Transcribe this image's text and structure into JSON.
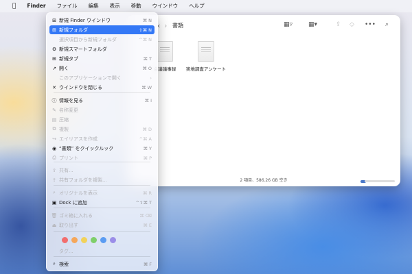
{
  "menubar": {
    "apple_icon": "apple-icon",
    "items": [
      "Finder",
      "ファイル",
      "編集",
      "表示",
      "移動",
      "ウインドウ",
      "ヘルプ"
    ]
  },
  "finder": {
    "back": "‹",
    "forward": "›",
    "title": "書類",
    "files": [
      {
        "name": "会議議事録"
      },
      {
        "name": "実地調査アンケート"
      }
    ],
    "status": "2 項目、586.26 GB 空き"
  },
  "menu": {
    "items": [
      {
        "icon": "⊞",
        "label": "新規 Finder ウインドウ",
        "shortcut": "⌘ N",
        "disabled": false,
        "highlight": false
      },
      {
        "icon": "⊞",
        "label": "新規フォルダ",
        "shortcut": "⇧⌘ N",
        "disabled": false,
        "highlight": true
      },
      {
        "icon": "",
        "label": "選択項目から新規フォルダ",
        "shortcut": "^⌘ N",
        "disabled": true,
        "highlight": false
      },
      {
        "icon": "⚙",
        "label": "新規スマートフォルダ",
        "shortcut": "",
        "disabled": false,
        "highlight": false
      },
      {
        "icon": "⊞",
        "label": "新規タブ",
        "shortcut": "⌘ T",
        "disabled": false,
        "highlight": false
      },
      {
        "icon": "↗",
        "label": "開く",
        "shortcut": "⌘ O",
        "disabled": false,
        "highlight": false
      },
      {
        "icon": "",
        "label": "このアプリケーションで開く",
        "shortcut": "›",
        "disabled": true,
        "highlight": false
      },
      {
        "icon": "✕",
        "label": "ウインドウを閉じる",
        "shortcut": "⌘ W",
        "disabled": false,
        "highlight": false
      },
      {
        "icon": "ⓘ",
        "label": "情報を見る",
        "shortcut": "⌘ I",
        "disabled": false,
        "highlight": false
      },
      {
        "icon": "✎",
        "label": "名称変更",
        "shortcut": "",
        "disabled": true,
        "highlight": false
      },
      {
        "icon": "▤",
        "label": "圧縮",
        "shortcut": "",
        "disabled": true,
        "highlight": false
      },
      {
        "icon": "⧉",
        "label": "複製",
        "shortcut": "⌘ D",
        "disabled": true,
        "highlight": false
      },
      {
        "icon": "↪",
        "label": "エイリアスを作成",
        "shortcut": "^⌘ A",
        "disabled": true,
        "highlight": false
      },
      {
        "icon": "◉",
        "label": "“書類” をクイックルック",
        "shortcut": "⌘ Y",
        "disabled": false,
        "highlight": false
      },
      {
        "icon": "⎙",
        "label": "プリント",
        "shortcut": "⌘ P",
        "disabled": true,
        "highlight": false
      },
      {
        "icon": "⇪",
        "label": "共有...",
        "shortcut": "",
        "disabled": true,
        "highlight": false
      },
      {
        "icon": "⇪",
        "label": "共有フォルダを複製...",
        "shortcut": "",
        "disabled": true,
        "highlight": false
      },
      {
        "icon": "⌕",
        "label": "オリジナルを表示",
        "shortcut": "⌘ R",
        "disabled": true,
        "highlight": false
      },
      {
        "icon": "▣",
        "label": "Dock に追加",
        "shortcut": "^⇧⌘ T",
        "disabled": false,
        "highlight": false
      },
      {
        "icon": "🗑",
        "label": "ゴミ箱に入れる",
        "shortcut": "⌘ ⌫",
        "disabled": true,
        "highlight": false
      },
      {
        "icon": "⏏",
        "label": "取り出す",
        "shortcut": "⌘ E",
        "disabled": true,
        "highlight": false
      },
      {
        "icon": "",
        "label": "タグ...",
        "shortcut": "",
        "disabled": true,
        "highlight": false
      },
      {
        "icon": "⌕",
        "label": "検索",
        "shortcut": "⌘ F",
        "disabled": false,
        "highlight": false
      }
    ],
    "tag_colors": [
      "#f26d6d",
      "#f5a75a",
      "#f2d25a",
      "#7fcf6a",
      "#5b9cf2",
      "#9b8ee8"
    ]
  }
}
